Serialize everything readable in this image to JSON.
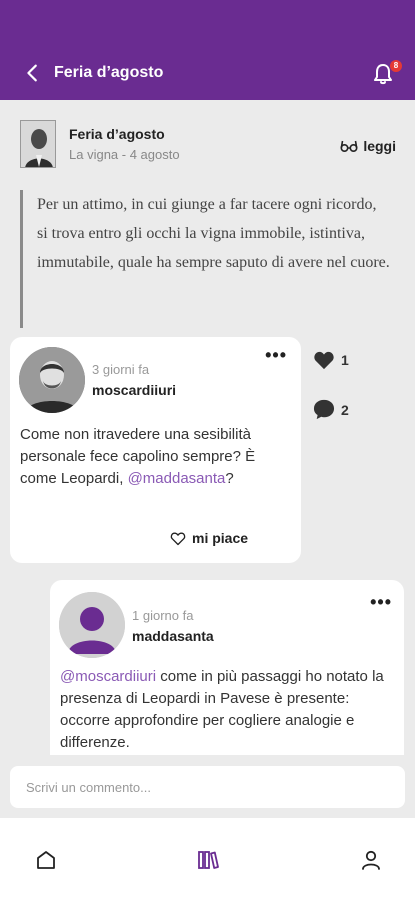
{
  "header": {
    "title": "Feria d’agosto",
    "notification_count": "8"
  },
  "post": {
    "title": "Feria d’agosto",
    "subtitle": "La vigna - 4 agosto",
    "read_label": "leggi",
    "quote": "Per un attimo, in cui giunge a far tacere ogni ricordo, si trova entro gli occhi la vigna immobile, istintiva, immutabile, quale ha sempre saputo di avere nel cuore."
  },
  "comments": [
    {
      "time": "3 giorni fa",
      "user": "moscardiiuri",
      "text_before": "Come non itravedere una sesibilità personale fece capolino sempre? È come Leopardi, ",
      "mention": "@maddasanta",
      "text_after": "?",
      "like_label": "mi piace",
      "like_count": "1",
      "reply_count": "2"
    },
    {
      "time": "1 giorno fa",
      "user": "maddasanta",
      "mention": "@moscardiiuri",
      "text_after": " come in più passaggi ho notato la presenza di Leopardi in Pavese è presente: occorre approfondire per cogliere analogie e differenze."
    }
  ],
  "comment_input": {
    "placeholder": "Scrivi un commento..."
  },
  "icons": {
    "back": "chevron-left-icon",
    "bell": "bell-icon",
    "read": "glasses-icon",
    "heart": "heart-icon",
    "comment": "speech-bubble-icon",
    "menu": "more-dots-icon",
    "home": "home-icon",
    "library": "library-icon",
    "profile": "user-icon"
  },
  "colors": {
    "accent": "#6a2c91",
    "badge": "#e53935",
    "mention": "#8a5ab5"
  }
}
